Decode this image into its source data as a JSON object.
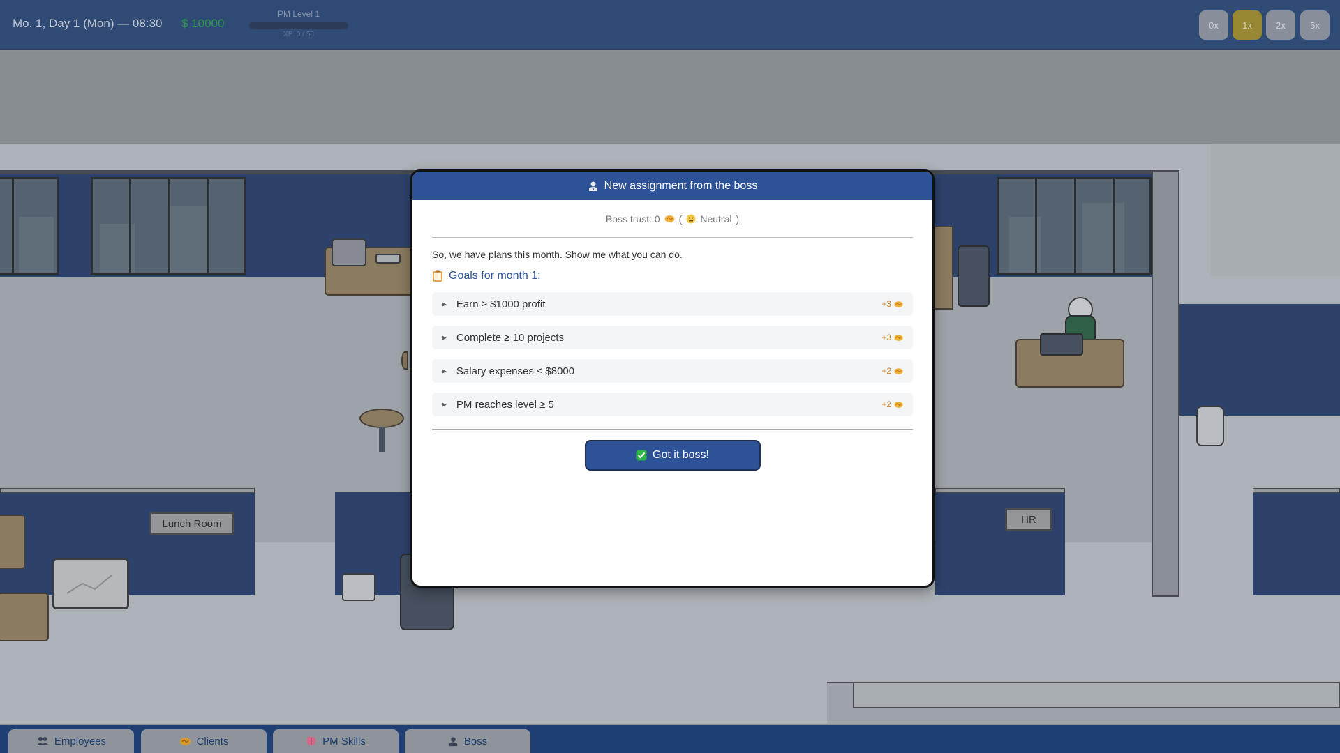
{
  "hud": {
    "date": "Mo. 1, Day 1 (Mon) — 08:30",
    "money": "$ 10000",
    "pm_level": "PM Level 1",
    "xp": "XP: 0 / 50",
    "xp_progress": 0,
    "speeds": [
      {
        "label": "0x",
        "active": false
      },
      {
        "label": "1x",
        "active": true
      },
      {
        "label": "2x",
        "active": false
      },
      {
        "label": "5x",
        "active": false
      }
    ]
  },
  "scene": {
    "signs": {
      "lunch_room": "Lunch Room",
      "hr": "HR"
    }
  },
  "modal": {
    "title": "New assignment from the boss",
    "boss_trust": "Boss trust: 0",
    "trust_state": "Neutral",
    "intro": "So, we have plans this month. Show me what you can do.",
    "goals_title": "Goals for month 1:",
    "goals": [
      {
        "text": "Earn ≥ $1000 profit",
        "points": "+3"
      },
      {
        "text": "Complete ≥ 10 projects",
        "points": "+3"
      },
      {
        "text": "Salary expenses ≤ $8000",
        "points": "+2"
      },
      {
        "text": "PM reaches level ≥ 5",
        "points": "+2"
      }
    ],
    "confirm_label": "Got it boss!"
  },
  "tabs": [
    {
      "label": "Employees",
      "icon": "people-icon"
    },
    {
      "label": "Clients",
      "icon": "handshake-icon"
    },
    {
      "label": "PM Skills",
      "icon": "brain-icon"
    },
    {
      "label": "Boss",
      "icon": "boss-icon"
    }
  ],
  "colors": {
    "hud_bg": "#1f3f72",
    "money_green": "#1f9a43",
    "active_speed": "#a08a22",
    "modal_header": "#2d5297",
    "points_orange": "#c77a1f"
  }
}
